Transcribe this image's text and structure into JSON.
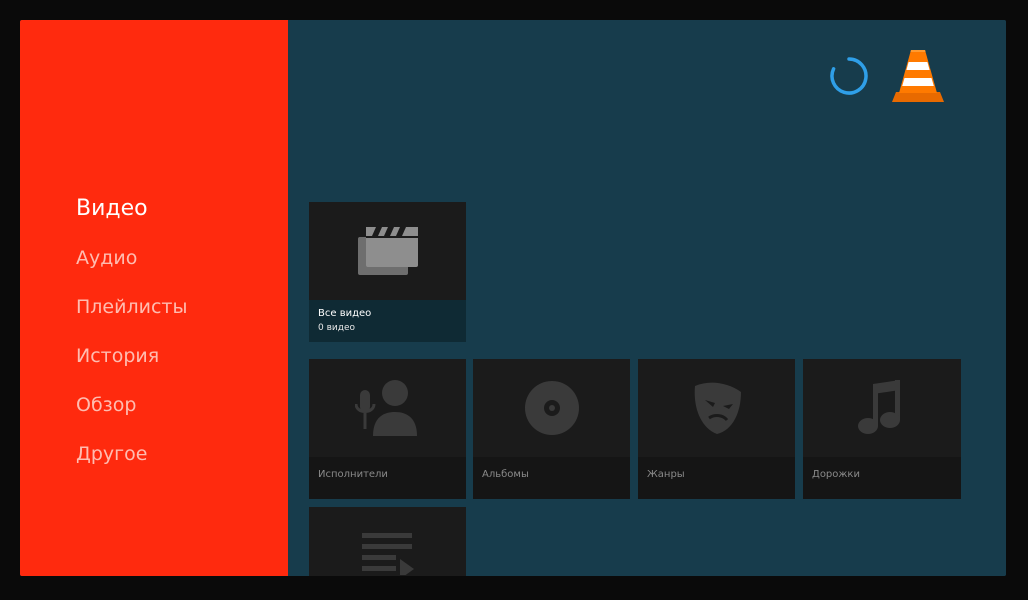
{
  "sidebar": {
    "items": [
      {
        "label": "Видео",
        "active": true
      },
      {
        "label": "Аудио",
        "active": false
      },
      {
        "label": "Плейлисты",
        "active": false
      },
      {
        "label": "История",
        "active": false
      },
      {
        "label": "Обзор",
        "active": false
      },
      {
        "label": "Другое",
        "active": false
      }
    ]
  },
  "header": {
    "loading_icon": "loading-spinner-icon",
    "logo_icon": "vlc-cone-icon"
  },
  "video_section": {
    "all_videos": {
      "title": "Все видео",
      "subtitle": "0 видео",
      "icon": "movie-clapper-icon"
    }
  },
  "audio_section": {
    "cards": [
      {
        "label": "Исполнители",
        "icon": "artist-mic-icon"
      },
      {
        "label": "Альбомы",
        "icon": "disc-icon"
      },
      {
        "label": "Жанры",
        "icon": "theater-mask-icon"
      },
      {
        "label": "Дорожки",
        "icon": "music-note-icon"
      }
    ],
    "playlists_card": {
      "icon": "playlist-icon"
    }
  },
  "colors": {
    "sidebar_bg": "#ff2a0e",
    "content_bg": "#173c4c",
    "card_bg": "#1b1b1b",
    "spinner": "#2f9fe8",
    "vlc_orange": "#ff7a00"
  }
}
